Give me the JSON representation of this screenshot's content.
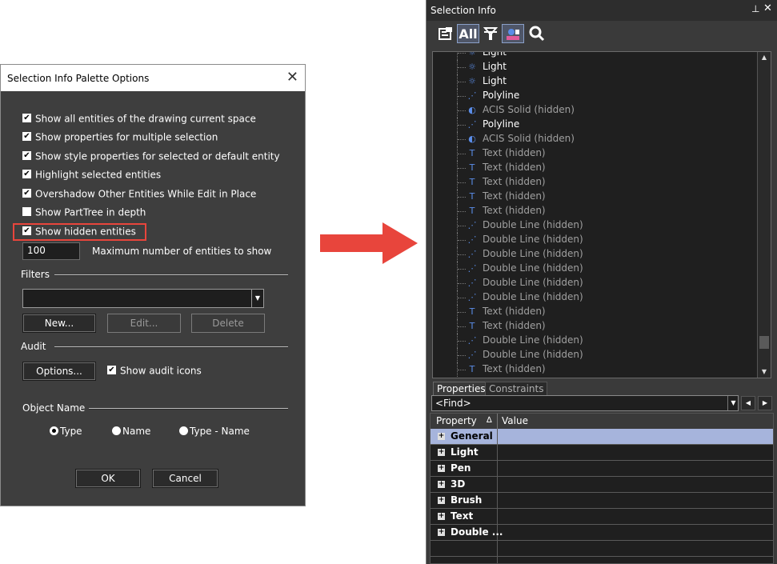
{
  "dialog": {
    "title": "Selection Info Palette Options",
    "close_glyph": "✕",
    "options": [
      {
        "label": "Show all entities of the drawing current space",
        "checked": true
      },
      {
        "label": "Show properties for multiple selection",
        "checked": true
      },
      {
        "label": "Show style properties for selected or default entity",
        "checked": true
      },
      {
        "label": "Highlight selected entities",
        "checked": true
      },
      {
        "label": "Overshadow Other Entities While Edit in Place",
        "checked": true
      },
      {
        "label": "Show PartTree in depth",
        "checked": false
      },
      {
        "label": "Show hidden entities",
        "checked": true
      }
    ],
    "max_entities_value": "100",
    "max_entities_label": "Maximum number of entities to show",
    "filters_label": "Filters",
    "new_button": "New...",
    "edit_button": "Edit...",
    "delete_button": "Delete",
    "audit_label": "Audit",
    "options_button": "Options...",
    "show_audit_icons_label": "Show audit icons",
    "show_audit_icons_checked": true,
    "object_name_label": "Object Name",
    "radio_type": "Type",
    "radio_name": "Name",
    "radio_type_name": "Type - Name",
    "radio_selected": "Type",
    "ok_button": "OK",
    "cancel_button": "Cancel",
    "highlight_color": "#e8453c"
  },
  "palette": {
    "title": "Selection Info",
    "pin_glyph": "📌",
    "close_glyph": "✕",
    "toolbar": {
      "all_label": "All"
    },
    "tree_items": [
      {
        "label": "Light",
        "hidden": false,
        "icon": "light-icon"
      },
      {
        "label": "Light",
        "hidden": false,
        "icon": "light-icon"
      },
      {
        "label": "Light",
        "hidden": false,
        "icon": "light-icon"
      },
      {
        "label": "Polyline",
        "hidden": false,
        "icon": "polyline-icon"
      },
      {
        "label": "ACIS Solid (hidden)",
        "hidden": true,
        "icon": "solid-icon"
      },
      {
        "label": "Polyline",
        "hidden": false,
        "icon": "polyline-icon"
      },
      {
        "label": "ACIS Solid (hidden)",
        "hidden": true,
        "icon": "solid-icon"
      },
      {
        "label": "Text (hidden)",
        "hidden": true,
        "icon": "text-icon"
      },
      {
        "label": "Text (hidden)",
        "hidden": true,
        "icon": "text-icon"
      },
      {
        "label": "Text (hidden)",
        "hidden": true,
        "icon": "text-icon"
      },
      {
        "label": "Text (hidden)",
        "hidden": true,
        "icon": "text-icon"
      },
      {
        "label": "Text (hidden)",
        "hidden": true,
        "icon": "text-icon"
      },
      {
        "label": "Double Line (hidden)",
        "hidden": true,
        "icon": "double-line-icon"
      },
      {
        "label": "Double Line (hidden)",
        "hidden": true,
        "icon": "double-line-icon"
      },
      {
        "label": "Double Line (hidden)",
        "hidden": true,
        "icon": "double-line-icon"
      },
      {
        "label": "Double Line (hidden)",
        "hidden": true,
        "icon": "double-line-icon"
      },
      {
        "label": "Double Line (hidden)",
        "hidden": true,
        "icon": "double-line-icon"
      },
      {
        "label": "Double Line (hidden)",
        "hidden": true,
        "icon": "double-line-icon"
      },
      {
        "label": "Text (hidden)",
        "hidden": true,
        "icon": "text-icon"
      },
      {
        "label": "Text (hidden)",
        "hidden": true,
        "icon": "text-icon"
      },
      {
        "label": "Double Line (hidden)",
        "hidden": true,
        "icon": "double-line-icon"
      },
      {
        "label": "Double Line (hidden)",
        "hidden": true,
        "icon": "double-line-icon"
      },
      {
        "label": "Text (hidden)",
        "hidden": true,
        "icon": "text-icon"
      }
    ],
    "tabs": [
      "Properties",
      "Constraints"
    ],
    "find_placeholder": "<Find>",
    "grid": {
      "col_property": "Property",
      "col_value": "Value",
      "sort_glyph": "∆",
      "rows": [
        {
          "name": "General",
          "selected": true
        },
        {
          "name": "Light",
          "selected": false
        },
        {
          "name": "Pen",
          "selected": false
        },
        {
          "name": "3D",
          "selected": false
        },
        {
          "name": "Brush",
          "selected": false
        },
        {
          "name": "Text",
          "selected": false
        },
        {
          "name": "Double ...",
          "selected": false
        }
      ]
    },
    "selected_row_color": "#a6b4dc"
  },
  "arrow_color": "#e8453c"
}
